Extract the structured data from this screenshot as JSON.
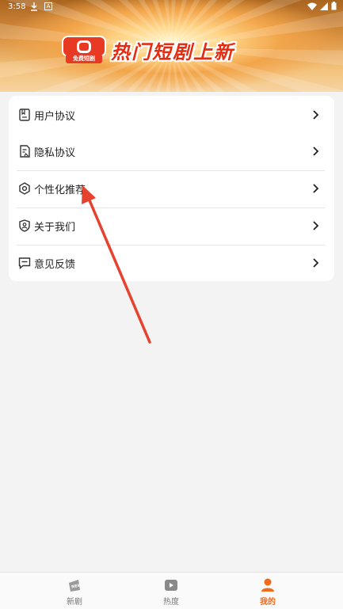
{
  "status_bar": {
    "time": "3:58",
    "download_icon": "download-icon",
    "a_badge": "A"
  },
  "banner": {
    "logo_text": "免费短剧",
    "title": "热门短剧上新"
  },
  "menu": {
    "items": [
      {
        "label": "用户协议",
        "icon": "document-icon"
      },
      {
        "label": "隐私协议",
        "icon": "privacy-doc-icon"
      },
      {
        "label": "个性化推荐",
        "icon": "settings-icon"
      },
      {
        "label": "关于我们",
        "icon": "user-shield-icon"
      },
      {
        "label": "意见反馈",
        "icon": "feedback-icon"
      }
    ]
  },
  "bottom_nav": {
    "items": [
      {
        "label": "新剧",
        "icon": "new-tag-icon",
        "active": false
      },
      {
        "label": "热度",
        "icon": "play-icon",
        "active": false
      },
      {
        "label": "我的",
        "icon": "profile-icon",
        "active": true
      }
    ]
  },
  "colors": {
    "accent": "#f26a1b",
    "annotation_arrow": "#e5432f",
    "banner_title": "#e52c10"
  }
}
